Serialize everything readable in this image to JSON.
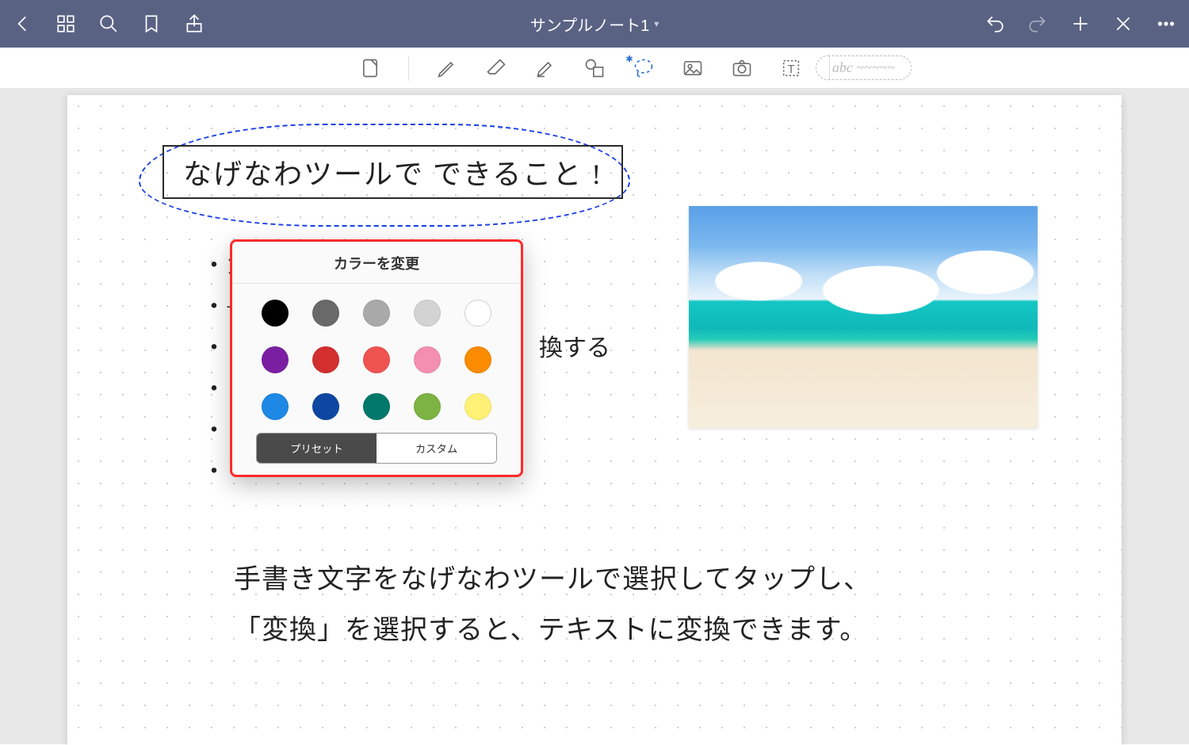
{
  "header": {
    "title": "サンプルノート1"
  },
  "abc_placeholder": "abc ~~~~~",
  "handwriting": {
    "title": "なげなわツールで できること !",
    "bullets": [
      "カ",
      "+",
      "",
      "換する",
      "",
      ""
    ],
    "bottom_line1": "手書き文字をなげなわツールで選択してタップし、",
    "bottom_line2": "「変換」を選択すると、テキストに変換できます。"
  },
  "popover": {
    "title": "カラーを変更",
    "preset_label": "プリセット",
    "custom_label": "カスタム",
    "colors": [
      "#000000",
      "#696969",
      "#a9a9a9",
      "#d3d3d3",
      "#ffffff",
      "#7b1fa2",
      "#d32f2f",
      "#ef5350",
      "#f48fb1",
      "#fb8c00",
      "#1e88e5",
      "#0d47a1",
      "#00796b",
      "#7cb342",
      "#fff176"
    ]
  }
}
